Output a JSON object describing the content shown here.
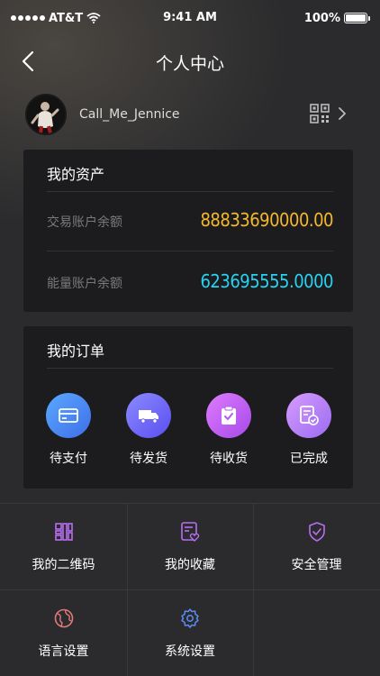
{
  "status_bar": {
    "carrier": "AT&T",
    "time": "9:41 AM",
    "battery": "100%"
  },
  "nav": {
    "title": "个人中心"
  },
  "profile": {
    "username": "Call_Me_Jennice"
  },
  "assets": {
    "title": "我的资产",
    "rows": [
      {
        "label": "交易账户余额",
        "value": "88833690000.00",
        "color": "#f5b82e"
      },
      {
        "label": "能量账户余额",
        "value": "623695555.0000",
        "color": "#27d3f0"
      }
    ]
  },
  "orders": {
    "title": "我的订单",
    "items": [
      {
        "label": "待支付",
        "icon": "card-icon"
      },
      {
        "label": "待发货",
        "icon": "truck-icon"
      },
      {
        "label": "待收货",
        "icon": "clipboard-check-icon"
      },
      {
        "label": "已完成",
        "icon": "document-check-icon"
      }
    ]
  },
  "menu": {
    "items": [
      {
        "label": "我的二维码",
        "icon": "grid-qr-icon"
      },
      {
        "label": "我的收藏",
        "icon": "favorites-icon"
      },
      {
        "label": "安全管理",
        "icon": "shield-check-icon"
      },
      {
        "label": "语言设置",
        "icon": "globe-icon"
      },
      {
        "label": "系统设置",
        "icon": "gear-icon"
      }
    ]
  },
  "colors": {
    "accent_purple": "#b76ef0",
    "gold": "#f5b82e",
    "cyan": "#27d3f0"
  }
}
